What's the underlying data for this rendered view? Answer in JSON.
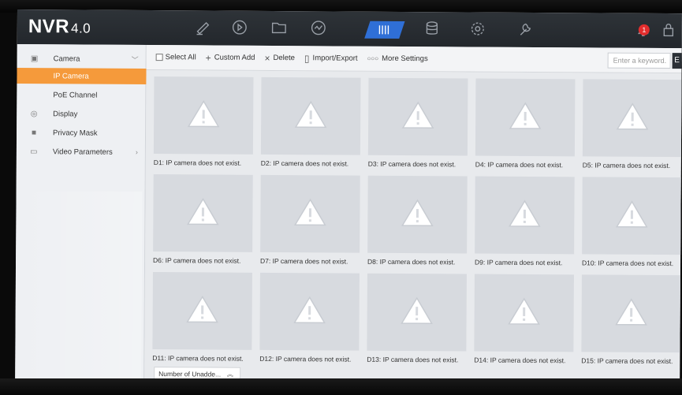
{
  "app": {
    "logo": "NVR",
    "version": "4.0",
    "alarm_count": "1"
  },
  "nav": [
    "edit-icon",
    "playback-icon",
    "folder-icon",
    "search-icon",
    "camera-config-icon",
    "storage-icon",
    "settings-icon",
    "maintenance-icon"
  ],
  "sidebar": {
    "items": [
      {
        "label": "Camera",
        "icon": "camera-icon"
      },
      {
        "label": "IP Camera"
      },
      {
        "label": "PoE Channel"
      },
      {
        "label": "Display",
        "icon": "eye-icon"
      },
      {
        "label": "Privacy Mask",
        "icon": "mask-icon"
      },
      {
        "label": "Video Parameters",
        "icon": "video-params-icon"
      }
    ]
  },
  "toolbar": {
    "select_all": "Select All",
    "custom_add": "Custom Add",
    "delete": "Delete",
    "import_export": "Import/Export",
    "more_settings": "More Settings",
    "search_placeholder": "Enter a keyword."
  },
  "cameras": [
    "D1: IP camera does not exist.",
    "D2: IP camera does not exist.",
    "D3: IP camera does not exist.",
    "D4: IP camera does not exist.",
    "D5: IP camera does not exist.",
    "D6: IP camera does not exist.",
    "D7: IP camera does not exist.",
    "D8: IP camera does not exist.",
    "D9: IP camera does not exist.",
    "D10: IP camera does not exist.",
    "D11: IP camera does not exist.",
    "D12: IP camera does not exist.",
    "D13: IP camera does not exist.",
    "D14: IP camera does not exist.",
    "D15: IP camera does not exist."
  ],
  "bottom": {
    "unadded_label": "Number of Unadde..."
  },
  "colors": {
    "accent": "#f59a3b",
    "active_nav": "#2f6fd6",
    "alarm": "#e22d2d"
  }
}
